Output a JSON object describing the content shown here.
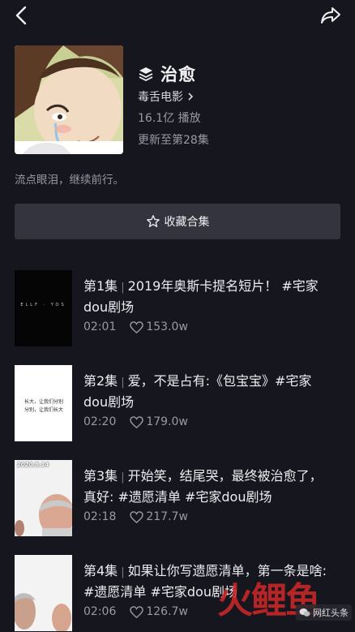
{
  "header": {
    "back_icon": "chevron-left-icon",
    "share_icon": "share-arrow-icon"
  },
  "collection": {
    "cover_icon": "anime-girl-crying-cover",
    "type_icon": "layers-icon",
    "title": "治愈",
    "author": "毒舌电影",
    "plays": "16.1亿 播放",
    "update": "更新至第28集",
    "description": "流点眼泪，继续前行。",
    "collect_label": "收藏合集"
  },
  "episodes": [
    {
      "ep": "第1集",
      "title": "2019年奥斯卡提名短片！ #宅家dou剧场",
      "duration": "02:01",
      "likes": "153.0w",
      "thumb_text": "ELLF · YOS"
    },
    {
      "ep": "第2集",
      "title": "爱，不是占有:《包宝宝》#宅家dou剧场",
      "duration": "02:20",
      "likes": "179.0w",
      "thumb_text_1": "长大，让我们分别",
      "thumb_text_2": "分别，让我们长大"
    },
    {
      "ep": "第3集",
      "title": "开始笑，结尾哭，最终被治愈了，真好: #遗愿清单 #宅家dou剧场",
      "duration": "02:18",
      "likes": "217.7w",
      "thumb_text": "2020.8.14"
    },
    {
      "ep": "第4集",
      "title": "如果让你写遗愿清单，第一条是啥: #遗愿清单 #宅家dou剧场",
      "duration": "02:06",
      "likes": "126.7w"
    }
  ],
  "watermark": {
    "logo": "火鲤鱼",
    "label": "网红头条",
    "colors": {
      "logo": "#d22828"
    }
  },
  "colors": {
    "background": "#16161f",
    "button": "#34343e",
    "muted": "#9a9aa4"
  }
}
